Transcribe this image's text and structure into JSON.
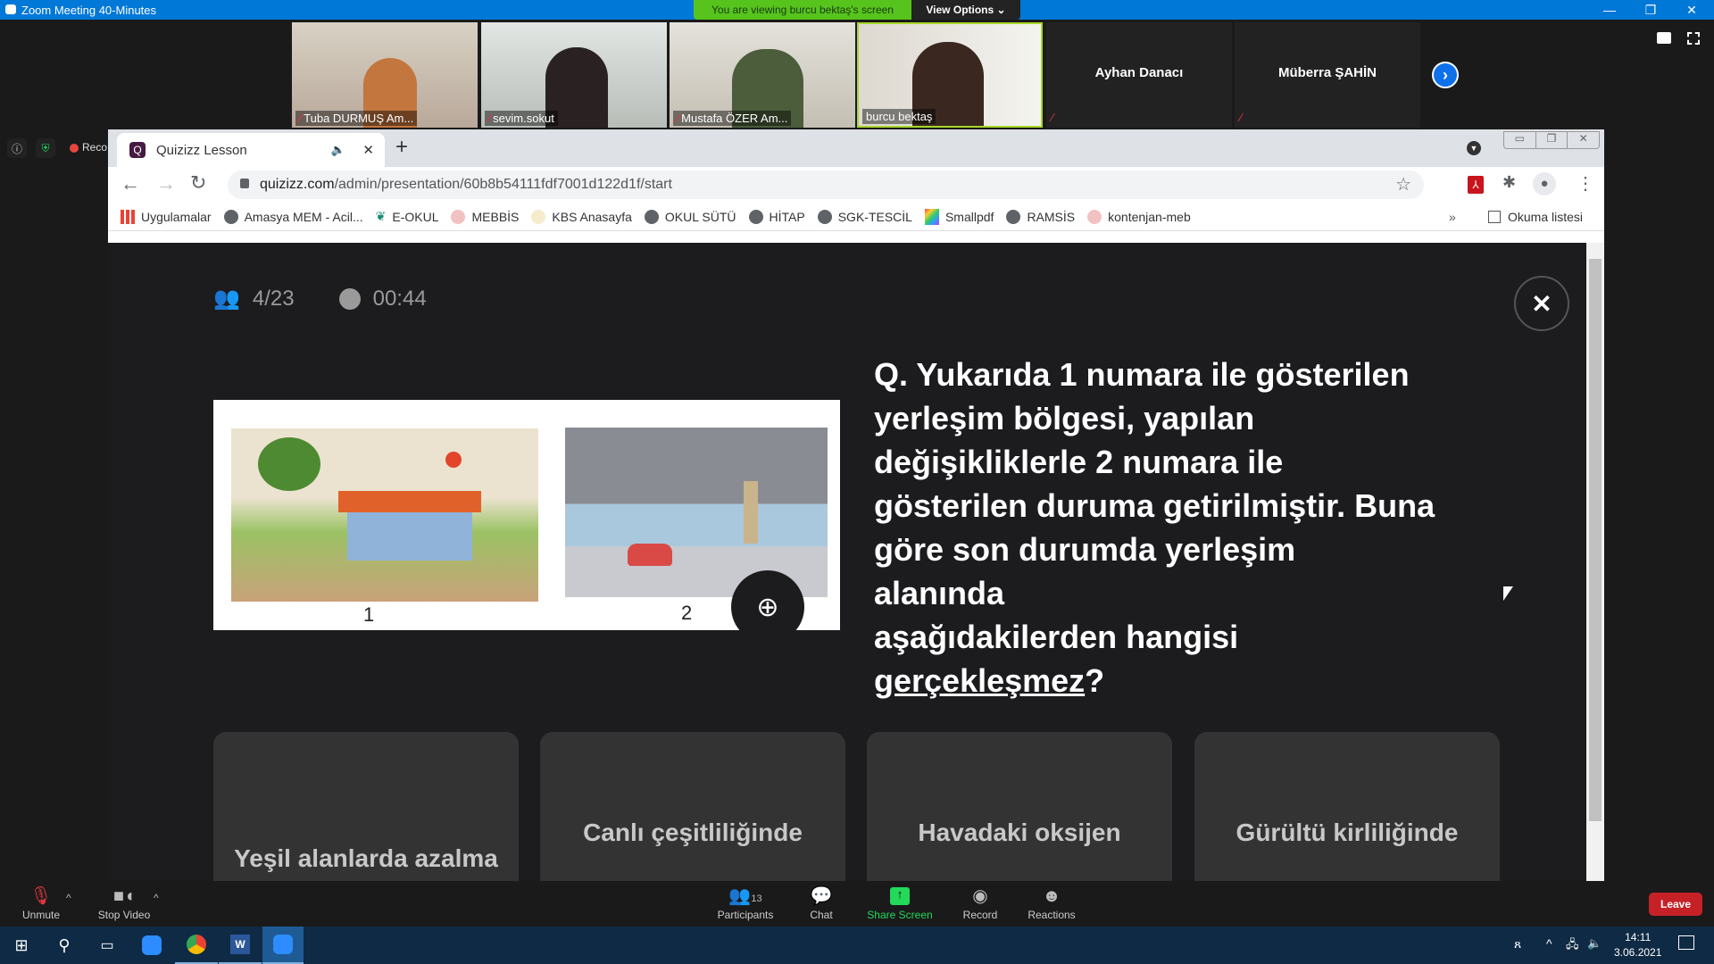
{
  "zoom_window": {
    "title": "Zoom Meeting 40-Minutes",
    "viewing_banner": "You are viewing burcu bektaş's screen",
    "view_options_label": "View Options",
    "window_controls": [
      "minimize",
      "restore",
      "close"
    ]
  },
  "participants_strip": [
    {
      "name": "Tuba DURMUŞ Am...",
      "muted": true,
      "video": true
    },
    {
      "name": "sevim.sokut",
      "muted": true,
      "video": true
    },
    {
      "name": "Mustafa ÖZER Am...",
      "muted": true,
      "video": true
    },
    {
      "name": "burcu bektaş",
      "muted": false,
      "video": true,
      "active_speaker": true
    },
    {
      "name": "Ayhan Danacı",
      "muted": true,
      "video": false
    },
    {
      "name": "Müberra ŞAHİN",
      "muted": true,
      "video": false
    }
  ],
  "meeting_status": {
    "recording_label": "Recording"
  },
  "browser": {
    "tab_title": "Quizizz Lesson",
    "url_domain": "quizizz.com",
    "url_path": "/admin/presentation/60b8b54111fdf7001d122d1f/start",
    "bookmarks": [
      {
        "label": "Uygulamalar",
        "icon": "apps-grid-icon"
      },
      {
        "label": "Amasya MEM - Acil...",
        "icon": "globe-icon"
      },
      {
        "label": "E-OKUL",
        "icon": "eokul-icon"
      },
      {
        "label": "MEBBİS",
        "icon": "meb-icon"
      },
      {
        "label": "KBS Anasayfa",
        "icon": "kbs-icon"
      },
      {
        "label": "OKUL SÜTÜ",
        "icon": "globe-icon"
      },
      {
        "label": "HİTAP",
        "icon": "globe-icon"
      },
      {
        "label": "SGK-TESCİL",
        "icon": "globe-icon"
      },
      {
        "label": "Smallpdf",
        "icon": "smallpdf-icon"
      },
      {
        "label": "RAMSİS",
        "icon": "globe-icon"
      },
      {
        "label": "kontenjan-meb",
        "icon": "meb-icon"
      }
    ],
    "more_bookmarks": "»",
    "reading_list": "Okuma listesi"
  },
  "quiz": {
    "responses": "4/23",
    "timer": "00:44",
    "image_labels": [
      "1",
      "2"
    ],
    "question_lines": [
      "Q. Yukarıda 1 numara ile gösterilen",
      "yerleşim bölgesi, yapılan",
      "değişikliklerle 2 numara ile",
      "gösterilen duruma getirilmiştir. Buna",
      "göre son durumda yerleşim",
      "alanında",
      "aşağıdakilerden hangisi"
    ],
    "question_underlined": "gerçekleşmez",
    "question_end": "?",
    "options": [
      "Yeşil alanlarda azalma",
      "Canlı çeşitliliğinde",
      "Havadaki oksijen",
      "Gürültü kirliliğinde"
    ]
  },
  "zoom_toolbar": {
    "unmute": "Unmute",
    "stop_video": "Stop Video",
    "participants": "Participants",
    "participants_count": "13",
    "chat": "Chat",
    "share_screen": "Share Screen",
    "record": "Record",
    "reactions": "Reactions",
    "leave": "Leave"
  },
  "taskbar": {
    "time": "14:11",
    "date": "3.06.2021"
  },
  "colors": {
    "zoom_blue": "#0078d7",
    "share_green": "#23d959",
    "leave_red": "#c52127",
    "quiz_bg": "#1c1b1e"
  }
}
